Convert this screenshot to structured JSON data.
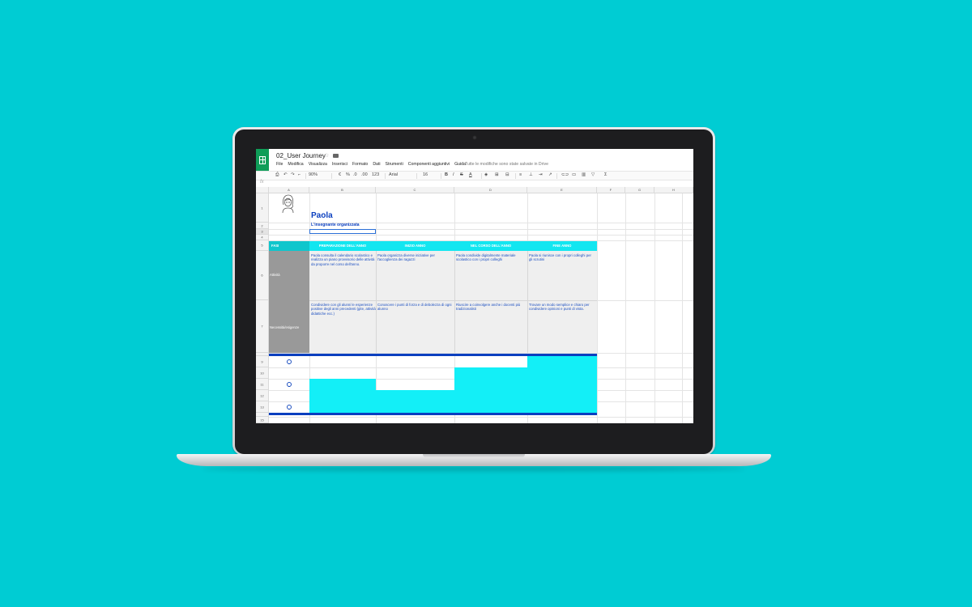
{
  "app": {
    "doc_title": "02_User Journey",
    "menu": [
      "File",
      "Modifica",
      "Visualizza",
      "Inserisci",
      "Formato",
      "Dati",
      "Strumenti",
      "Componenti aggiuntivi",
      "Guida"
    ],
    "saved_message": "Tutte le modifiche sono state salvate in Drive"
  },
  "toolbar": {
    "zoom": "90%",
    "euro": "€",
    "percent": "%",
    "dec_less": ".0",
    "dec_more": ".00",
    "number_format": "123",
    "font": "Arial",
    "font_size": "16",
    "bold": "B",
    "italic": "I",
    "strike": "S",
    "text_color": "A",
    "sum": "Σ"
  },
  "formula_bar": {
    "icon": "fx",
    "value": ""
  },
  "columns": [
    "A",
    "B",
    "C",
    "D",
    "E",
    "F",
    "G",
    "H"
  ],
  "rows": [
    "1",
    "2",
    "3",
    "4",
    "5",
    "6",
    "7",
    "8",
    "9",
    "10",
    "11",
    "12",
    "13",
    "14",
    "15"
  ],
  "persona": {
    "name": "Paola",
    "subtitle": "L'insegnante organizzata"
  },
  "journey": {
    "corner_label": "FASI",
    "phases": [
      "PREPARAZIONE DELL'ANNO",
      "INIZIO ANNO",
      "NEL CORSO DELL'ANNO",
      "FINE ANNO"
    ],
    "row_labels": [
      "Attività",
      "Necessità/esigenze"
    ],
    "activities": [
      "Paola consulta il calendario scolastico e realizza un piano provvisorio delle attività da proporre nel corso dell'anno.",
      "Paola organizza diverse iniziative per l'accoglienza dei ragazzi",
      "Paola condivide digitalmente materiale scolastico con i propri colleghi",
      "Paola si riunisce con i propri colleghi per gli scrutini"
    ],
    "needs": [
      "Condividere con gli alunni le esperienze positive degli anni precedenti (gite, attività didattiche ecc.)",
      "Conoscere i punti di forza e di debolezza di ogni alunno",
      "Riuscire a coinvolgere anche i docenti più tradizionalisti",
      "Trovare un modo semplice e chiaro per condividere opinioni e punti di vista."
    ],
    "emotion_levels": [
      0.33,
      0.67,
      1.0,
      1.33
    ]
  },
  "colors": {
    "background": "#00CCD3",
    "accent_cyan": "#13EFF7",
    "accent_blue": "#0B3FBF",
    "sheets_green": "#0F9D58"
  }
}
